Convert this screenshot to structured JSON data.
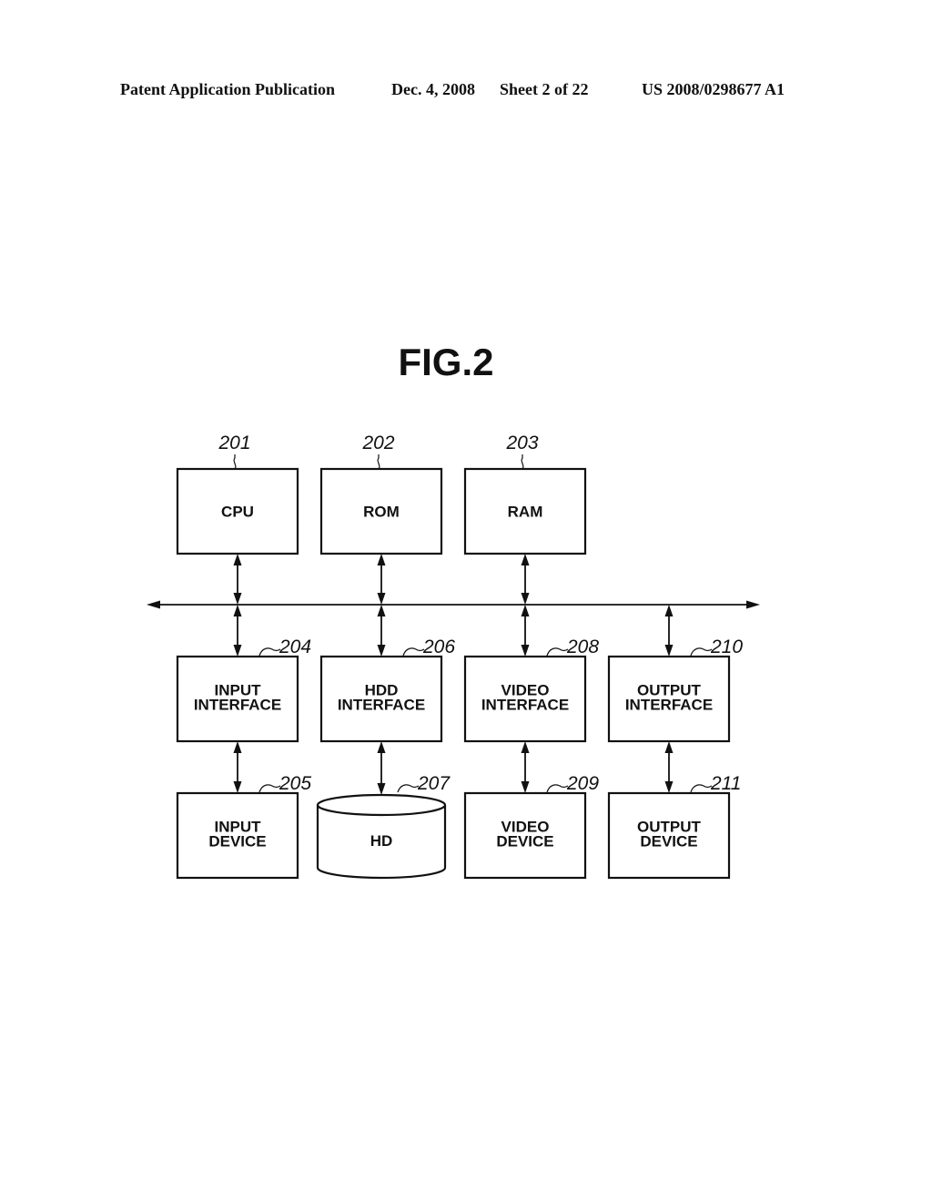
{
  "header": {
    "publication": "Patent Application Publication",
    "date": "Dec. 4, 2008",
    "sheet": "Sheet 2 of 22",
    "number": "US 2008/0298677 A1"
  },
  "figure": {
    "title": "FIG.2",
    "top_row": [
      {
        "id": "cpu",
        "ref": "201",
        "lines": [
          "CPU"
        ]
      },
      {
        "id": "rom",
        "ref": "202",
        "lines": [
          "ROM"
        ]
      },
      {
        "id": "ram",
        "ref": "203",
        "lines": [
          "RAM"
        ]
      }
    ],
    "interfaces": [
      {
        "id": "input-interface",
        "ref": "204",
        "lines": [
          "INPUT",
          "INTERFACE"
        ]
      },
      {
        "id": "hdd-interface",
        "ref": "206",
        "lines": [
          "HDD",
          "INTERFACE"
        ]
      },
      {
        "id": "video-interface",
        "ref": "208",
        "lines": [
          "VIDEO",
          "INTERFACE"
        ]
      },
      {
        "id": "output-interface",
        "ref": "210",
        "lines": [
          "OUTPUT",
          "INTERFACE"
        ]
      }
    ],
    "devices": [
      {
        "id": "input-device",
        "ref": "205",
        "lines": [
          "INPUT",
          "DEVICE"
        ],
        "shape": "box"
      },
      {
        "id": "hd",
        "ref": "207",
        "lines": [
          "HD"
        ],
        "shape": "cylinder"
      },
      {
        "id": "video-device",
        "ref": "209",
        "lines": [
          "VIDEO",
          "DEVICE"
        ],
        "shape": "box"
      },
      {
        "id": "output-device",
        "ref": "211",
        "lines": [
          "OUTPUT",
          "DEVICE"
        ],
        "shape": "box"
      }
    ],
    "bus": {
      "direction": "bidirectional"
    }
  }
}
